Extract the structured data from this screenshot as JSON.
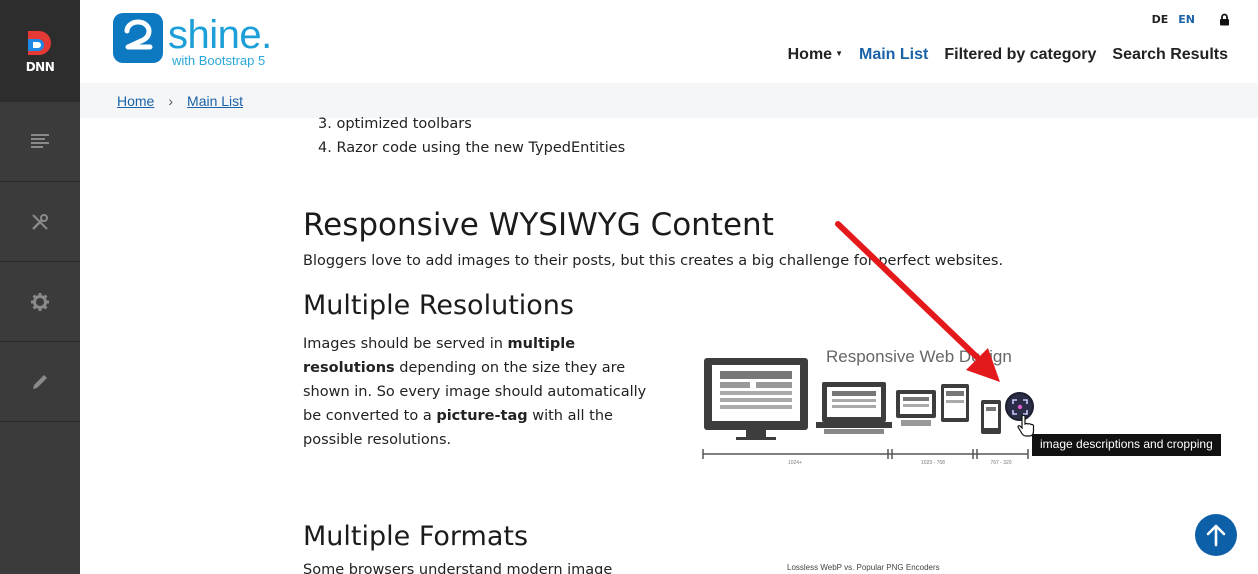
{
  "rail": {
    "logo_text": "DNN",
    "buttons": [
      {
        "icon": "content-list-icon"
      },
      {
        "icon": "tools-icon"
      },
      {
        "icon": "settings-gear-icon"
      },
      {
        "icon": "edit-pencil-icon"
      }
    ]
  },
  "header": {
    "brand_digit": "2",
    "brand_word": "shine.",
    "brand_sub": "with Bootstrap 5",
    "langs": [
      "DE",
      "EN"
    ],
    "nav": [
      {
        "label": "Home",
        "has_caret": true,
        "active": false
      },
      {
        "label": "Main List",
        "has_caret": false,
        "active": true
      },
      {
        "label": "Filtered by category",
        "has_caret": false,
        "active": false
      },
      {
        "label": "Search Results",
        "has_caret": false,
        "active": false
      }
    ]
  },
  "breadcrumb": {
    "items": [
      "Home",
      "Main List"
    ],
    "separator": "›"
  },
  "content": {
    "list_items": [
      "3. optimized toolbars",
      "4. Razor code using the new TypedEntities"
    ],
    "heading_responsive": "Responsive WYSIWYG Content",
    "intro": "Bloggers love to add images to their posts, but this creates a big challenge for perfect websites.",
    "heading_resolutions": "Multiple Resolutions",
    "res_p1": "Images should be served in ",
    "res_b1": "multiple resolutions",
    "res_p2": " depending on the size they are shown in. So every image should automatically be converted to a ",
    "res_b2": "picture-tag",
    "res_p3": " with all the possible resolutions.",
    "heading_formats": "Multiple Formats",
    "formats_intro": "Some browsers understand modern image"
  },
  "illustration": {
    "title": "Responsive Web Design",
    "scale_labels": [
      "1024+",
      "1023 - 768",
      "767 - 320"
    ]
  },
  "tooltip": "image descriptions and cropping",
  "webp_caption": "Lossless WebP vs. Popular PNG Encoders",
  "colors": {
    "accent_blue": "#1a63a8",
    "annotation_red": "#e3191c",
    "rail_bg": "#3b3b3b"
  }
}
